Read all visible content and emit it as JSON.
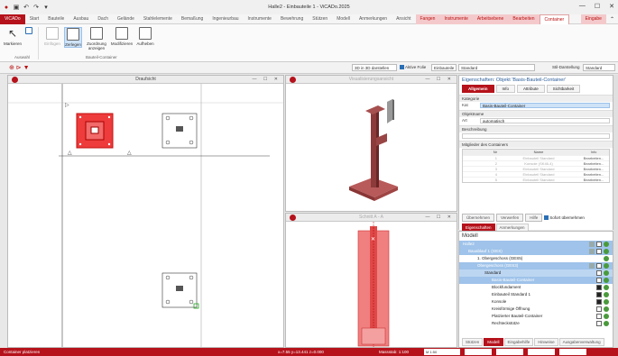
{
  "window": {
    "title": "Halle2 - Einbauteile 1 - ViCADo.2025",
    "controls": [
      "—",
      "☐",
      "✕"
    ]
  },
  "tabs": {
    "app": "ViCADo",
    "items": [
      "Start",
      "Bauteile",
      "Ausbau",
      "Dach",
      "Gelände",
      "Stahlelemente",
      "Bemaßung",
      "Ingenieurbau",
      "Instrumente",
      "Bewehrung",
      "Stützen",
      "Modell",
      "Anmerkungen",
      "Ansicht"
    ],
    "context": [
      "Fangen",
      "Instrumente",
      "Arbeitsebene",
      "Bearbeiten"
    ],
    "active": "Container",
    "right": "Eingabe"
  },
  "ribbon": {
    "buttons": {
      "markieren": "Markieren",
      "einfuegen": "Einfügen",
      "zerlegen": "Zerlegen",
      "zuordnung": "Zuordnung anzeigen",
      "modifizieren": "Modifizieren",
      "aufheben": "Aufheben"
    },
    "groups": {
      "auswahl": "Auswahl",
      "container": "Bauteil-Container"
    }
  },
  "subbar": {
    "show3d": "3D in 3D darstellen",
    "active_folie_label": "Aktive Folie",
    "active_folie": "Einbauteile",
    "standard": "Standard",
    "stil_label": "Stil-Darstellung",
    "stil": "Standard"
  },
  "panels": {
    "draufsicht": {
      "title": "Draufsicht",
      "controls": "— ☐ ✕"
    },
    "visual": {
      "title": "Visualisierungsansicht",
      "controls": "— ☐ ✕"
    },
    "schnitt": {
      "title": "Schnitt A - A",
      "controls": "— ☐ ✕"
    }
  },
  "properties": {
    "title": "Eigenschaften: Objekt 'Basis-Bauteil-Container'",
    "tabs": [
      "Allgemein",
      "Info",
      "Attribute",
      "Sichtbarkeit"
    ],
    "kategorie_label": "Kategorie",
    "kat_key": "Kat",
    "kat_value": "Basis-Bauteil-Container",
    "objektname_label": "Objektname",
    "art_key": "Art",
    "art_value": "automatisch",
    "beschreibung_label": "Beschreibung",
    "mitglieder_label": "Mitglieder des Containers",
    "table_headers": [
      "Nr",
      "Name",
      "Info"
    ],
    "members": [
      {
        "nr": "1",
        "name": "Einbauteil Standard",
        "info": "Bearbeiten..."
      },
      {
        "nr": "2",
        "name": "Konsole (SK46-4)",
        "info": "Bearbeiten..."
      },
      {
        "nr": "3",
        "name": "Einbauteil Standard",
        "info": "Bearbeiten..."
      },
      {
        "nr": "4",
        "name": "Einbauteil Standard",
        "info": "Bearbeiten..."
      },
      {
        "nr": "5",
        "name": "Einbauteil Standard",
        "info": "Bearbeiten..."
      }
    ],
    "buttons": [
      "Übernehmen",
      "Verwerfen",
      "Hilfe"
    ],
    "sofort": "Sofort übernehmen",
    "bottom_tabs": [
      "Eigenschaften",
      "Anmerkungen"
    ]
  },
  "model": {
    "title": "Modell",
    "rows": [
      {
        "text": "Halle2"
      },
      {
        "text": "Bauablauf 1 (GES)"
      },
      {
        "text": "1. Obergeschoss (GES5)"
      },
      {
        "text": "Obergeschoss (GES3)"
      },
      {
        "text": "Standard"
      },
      {
        "text": "Basis-Bauteil-Container"
      },
      {
        "text": "Blockfundament"
      },
      {
        "text": "Einbauteil Standard 1"
      },
      {
        "text": "Konsole"
      },
      {
        "text": "Kreisförmige Öffnung"
      },
      {
        "text": "Platzierter Bauteil-Container"
      },
      {
        "text": "Rechteckstütze"
      }
    ],
    "bottom_tabs": [
      "Stützen",
      "Modell",
      "Eingabehilfe",
      "Hinweise",
      "Ausgabenverwaltung"
    ]
  },
  "status": {
    "text": "Container platzieren",
    "coords": "x=7.55  y=13.441  z=0.000",
    "scale": "Massstab: 1:100",
    "zoom": "M 1:50"
  },
  "colors": {
    "accent": "#b5121b",
    "selection": "#cfe3f7"
  }
}
